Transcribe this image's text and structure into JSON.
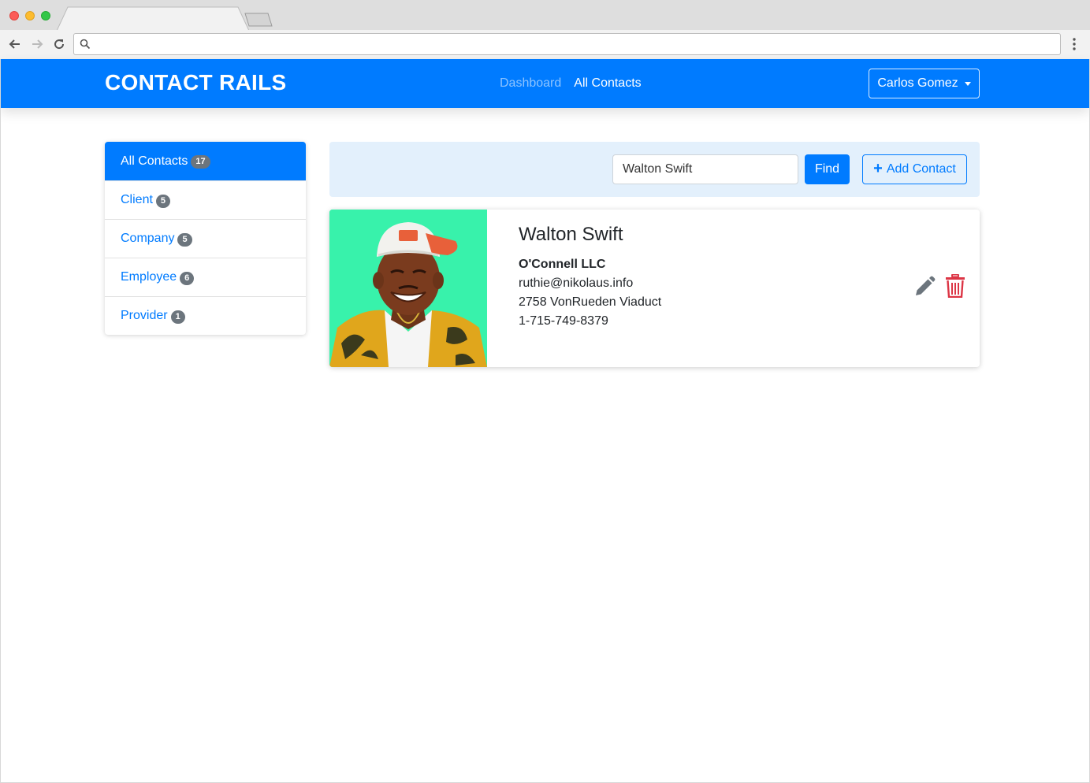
{
  "browser": {
    "address_value": "",
    "address_placeholder": ""
  },
  "navbar": {
    "brand": "CONTACT RAILS",
    "links": [
      {
        "label": "Dashboard",
        "active": false
      },
      {
        "label": "All Contacts",
        "active": true
      }
    ],
    "user": "Carlos Gomez"
  },
  "sidebar": {
    "items": [
      {
        "label": "All Contacts",
        "count": "17",
        "active": true
      },
      {
        "label": "Client",
        "count": "5",
        "active": false
      },
      {
        "label": "Company",
        "count": "5",
        "active": false
      },
      {
        "label": "Employee",
        "count": "6",
        "active": false
      },
      {
        "label": "Provider",
        "count": "1",
        "active": false
      }
    ]
  },
  "search": {
    "value": "Walton Swift",
    "find_label": "Find",
    "add_label": "Add Contact"
  },
  "contact": {
    "name": "Walton Swift",
    "company": "O'Connell LLC",
    "email": "ruthie@nikolaus.info",
    "address": "2758 VonRueden Viaduct",
    "phone": "1-715-749-8379"
  },
  "colors": {
    "primary": "#007bff",
    "danger": "#dc3545",
    "avatar_bg": "#38f2ab",
    "badge": "#6c757d"
  },
  "icons": {
    "edit": "pencil-icon",
    "delete": "trash-icon",
    "add": "plus-icon"
  }
}
